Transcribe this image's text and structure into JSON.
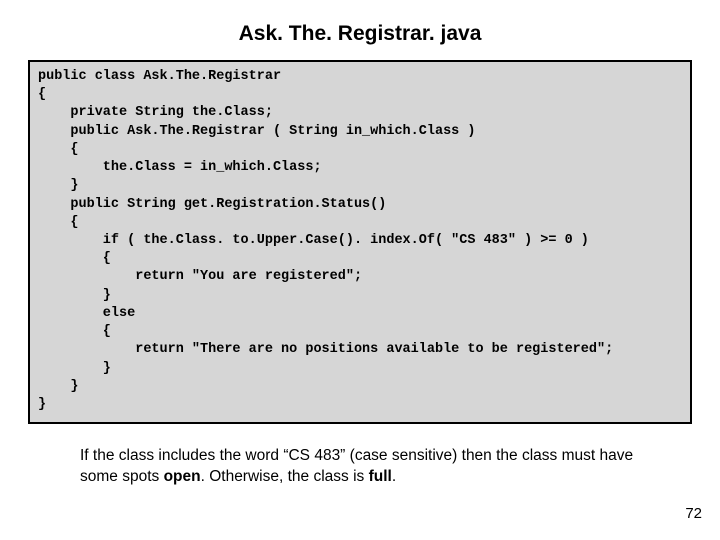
{
  "title": "Ask. The. Registrar. java",
  "code": "public class Ask.The.Registrar\n{\n    private String the.Class;\n    public Ask.The.Registrar ( String in_which.Class )\n    {\n        the.Class = in_which.Class;\n    }\n    public String get.Registration.Status()\n    {\n        if ( the.Class. to.Upper.Case(). index.Of( \"CS 483\" ) >= 0 )\n        {\n            return \"You are registered\";\n        }\n        else\n        {\n            return \"There are no positions available to be registered\";\n        }\n    }\n}",
  "caption": {
    "part1": "If the class includes the word “CS 483” (case sensitive) then the class must have some spots ",
    "open": "open",
    "part2": ". Otherwise, the class is ",
    "full": "full",
    "part3": "."
  },
  "page_number": "72"
}
